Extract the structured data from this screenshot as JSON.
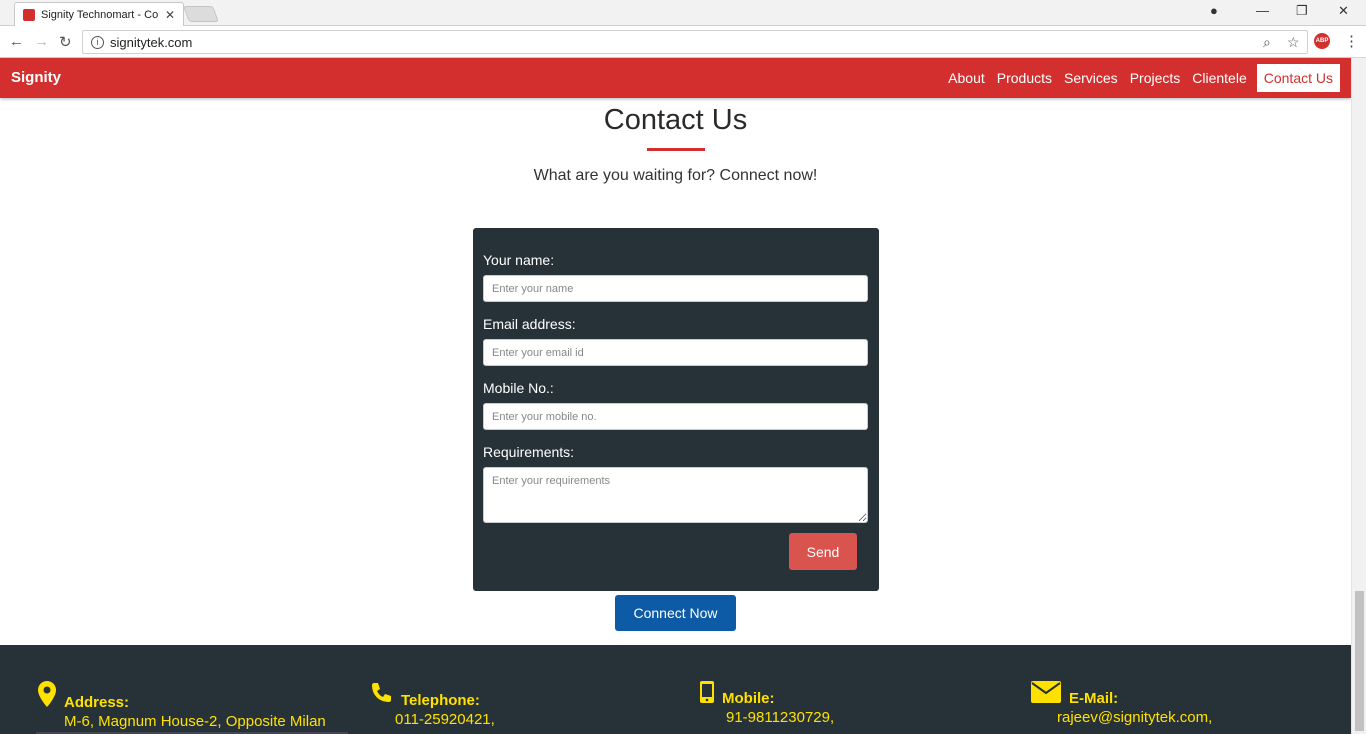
{
  "browser": {
    "tab_title": "Signity Technomart - Co",
    "tab_close": "✕",
    "url": "signitytek.com",
    "extension_badge": "ABP"
  },
  "navbar": {
    "brand": "Signity",
    "items": [
      {
        "label": "About"
      },
      {
        "label": "Products"
      },
      {
        "label": "Services"
      },
      {
        "label": "Projects"
      },
      {
        "label": "Clientele"
      },
      {
        "label": "Contact Us",
        "active": true
      }
    ]
  },
  "section": {
    "title": "Contact Us",
    "subtitle": "What are you waiting for? Connect now!"
  },
  "form": {
    "name_label": "Your name:",
    "name_placeholder": "Enter your name",
    "email_label": "Email address:",
    "email_placeholder": "Enter your email id",
    "mobile_label": "Mobile No.:",
    "mobile_placeholder": "Enter your mobile no.",
    "requirements_label": "Requirements:",
    "requirements_placeholder": "Enter your requirements",
    "send_label": "Send"
  },
  "connect_label": "Connect Now",
  "footer": {
    "address_label": "Address:",
    "address_value": "M-6, Magnum House-2, Opposite Milan",
    "telephone_label": "Telephone:",
    "telephone_value": "011-25920421,",
    "mobile_label": "Mobile:",
    "mobile_value": "91-9811230729,",
    "email_label": "E-Mail:",
    "email_value": "rajeev@signitytek.com,"
  },
  "colors": {
    "brand_red": "#d32f2f",
    "dark_panel": "#263238",
    "connect_blue": "#0d5aa7",
    "footer_yellow": "#ffe100"
  }
}
